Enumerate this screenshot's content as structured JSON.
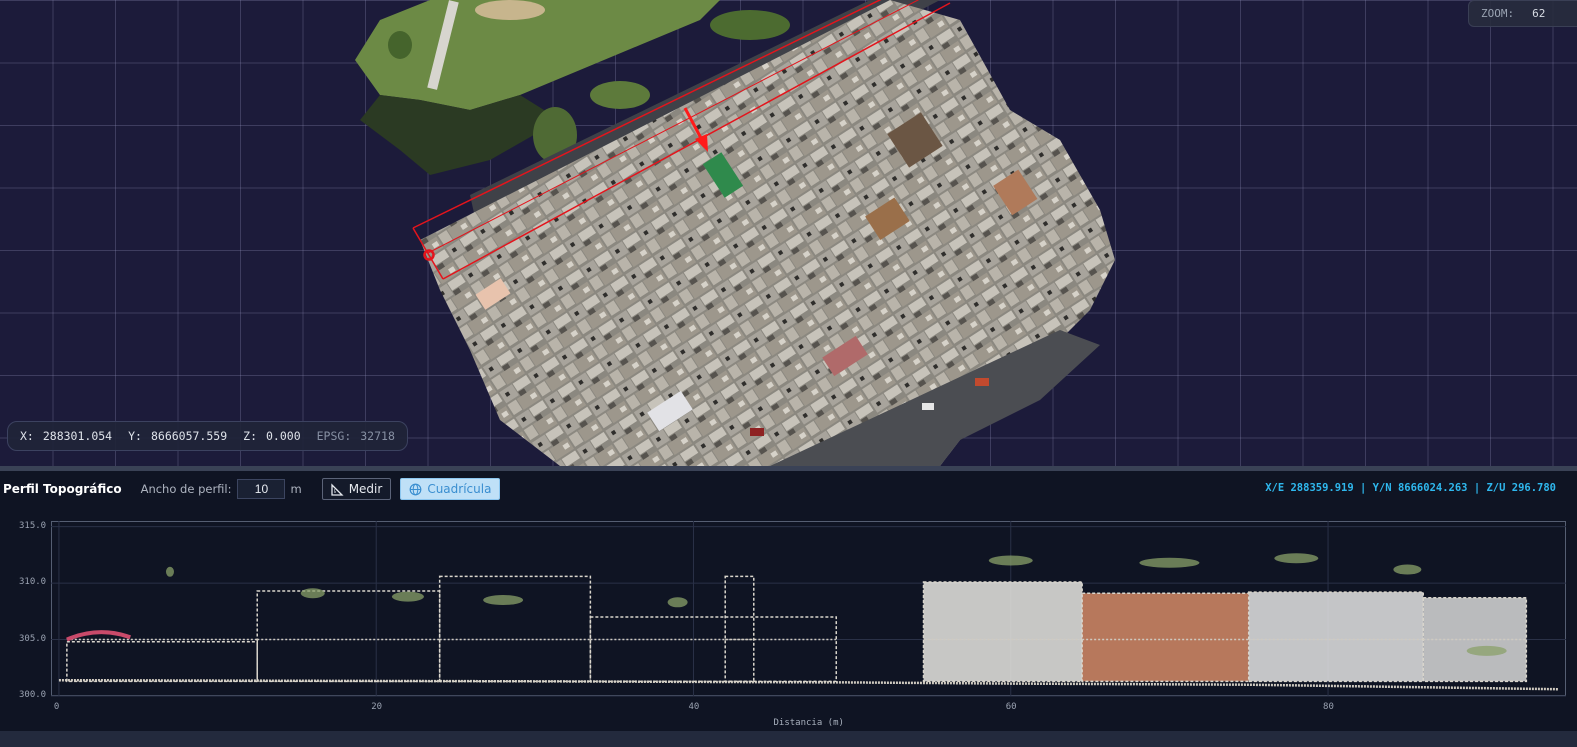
{
  "viewport": {
    "zoom": {
      "label": "ZOOM:",
      "value": "62"
    },
    "coords": {
      "x_label": "X:",
      "x": "288301.054",
      "y_label": "Y:",
      "y": "8666057.559",
      "z_label": "Z:",
      "z": "0.000",
      "epsg_label": "EPSG:",
      "epsg": "32718"
    }
  },
  "profile": {
    "title": "Perfil Topográfico",
    "width_label": "Ancho de perfil:",
    "width_value": "10",
    "width_unit": "m",
    "measure_button": "Medir",
    "grid_button": "Cuadrícula",
    "cursor_readout": "X/E 288359.919 | Y/N 8666024.263 | Z/U 296.780"
  },
  "chart_data": {
    "type": "scatter",
    "xlabel": "Distancia (m)",
    "ylabel": "",
    "xlim": [
      -0.5,
      95
    ],
    "ylim": [
      300,
      315.5
    ],
    "x_ticks": [
      "0",
      "20",
      "40",
      "60",
      "80"
    ],
    "y_ticks": [
      "315.0",
      "310.0",
      "305.0",
      "300.0"
    ],
    "grid": true
  },
  "colors": {
    "viewport_bg": "#1c1b3a",
    "panel_bg": "#0f1423",
    "accent": "#2fb8ee",
    "profile_line": "#e4141c"
  }
}
